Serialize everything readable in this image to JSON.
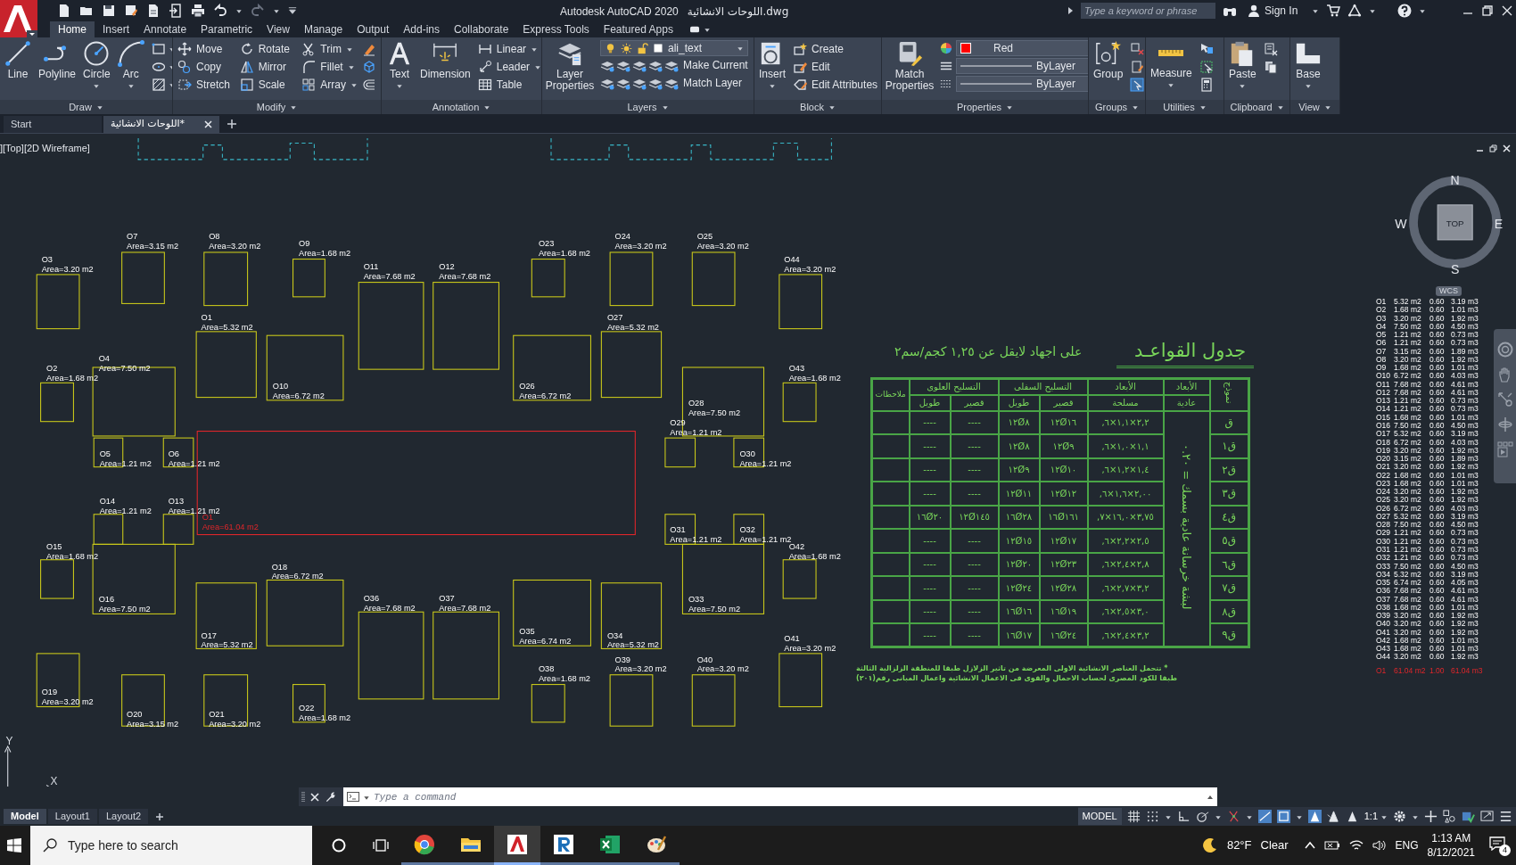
{
  "title_bar": {
    "app": "Autodesk AutoCAD 2020",
    "file": "اللوحات الانشائية.dwg",
    "search": {
      "placeholder": "Type a keyword or phrase"
    },
    "sign_in": "Sign In"
  },
  "ribbon_tabs": [
    {
      "label": "Home",
      "selected": true
    },
    {
      "label": "Insert",
      "selected": false
    },
    {
      "label": "Annotate",
      "selected": false
    },
    {
      "label": "Parametric",
      "selected": false
    },
    {
      "label": "View",
      "selected": false
    },
    {
      "label": "Manage",
      "selected": false
    },
    {
      "label": "Output",
      "selected": false
    },
    {
      "label": "Add-ins",
      "selected": false
    },
    {
      "label": "Collaborate",
      "selected": false
    },
    {
      "label": "Express Tools",
      "selected": false
    },
    {
      "label": "Featured Apps",
      "selected": false
    }
  ],
  "ribbon_panels": [
    {
      "title": "Draw",
      "tools": [
        "Line",
        "Polyline",
        "Circle",
        "Arc"
      ]
    },
    {
      "title": "Modify",
      "tools": [
        "Move",
        "Rotate",
        "Trim",
        "Copy",
        "Mirror",
        "Fillet",
        "Stretch",
        "Scale",
        "Array"
      ]
    },
    {
      "title": "Annotation",
      "tools": [
        "Text",
        "Dimension",
        "Linear",
        "Leader",
        "Table"
      ]
    },
    {
      "title": "Layers",
      "tools": [
        "Layer Properties",
        "Make Current",
        "Match Layer"
      ],
      "layer": "ali_text"
    },
    {
      "title": "Block",
      "tools": [
        "Insert",
        "Create",
        "Edit",
        "Edit Attributes"
      ]
    },
    {
      "title": "Properties",
      "tools": [
        "Match Properties"
      ],
      "color": {
        "label": "Red",
        "color": "#ff0000"
      },
      "linetype": "ByLayer",
      "lineweight": "ByLayer"
    },
    {
      "title": "Groups",
      "tools": [
        "Group"
      ]
    },
    {
      "title": "Utilities",
      "tools": [
        "Measure"
      ]
    },
    {
      "title": "Clipboard",
      "tools": [
        "Paste"
      ]
    },
    {
      "title": "View",
      "tools": [
        "Base"
      ]
    }
  ],
  "file_tabs": [
    {
      "label": "Start",
      "selected": false
    },
    {
      "label": "اللوحات الانشائية*",
      "selected": true
    }
  ],
  "viewport": {
    "label": "][Top][2D Wireframe]"
  },
  "footings": [
    {
      "name": "O3",
      "area": "Area=3.20 m2"
    },
    {
      "name": "O7",
      "area": "Area=3.15 m2"
    },
    {
      "name": "O8",
      "area": "Area=3.20 m2"
    },
    {
      "name": "O9",
      "area": "Area=1.68 m2"
    },
    {
      "name": "O11",
      "area": "Area=7.68 m2"
    },
    {
      "name": "O12",
      "area": "Area=7.68 m2"
    },
    {
      "name": "O23",
      "area": "Area=1.68 m2"
    },
    {
      "name": "O24",
      "area": "Area=3.20 m2"
    },
    {
      "name": "O25",
      "area": "Area=3.20 m2"
    },
    {
      "name": "O44",
      "area": "Area=3.20 m2"
    },
    {
      "name": "O1",
      "area": "Area=5.32 m2"
    },
    {
      "name": "O27",
      "area": "Area=5.32 m2"
    },
    {
      "name": "O10",
      "area": "Area=6.72 m2"
    },
    {
      "name": "O26",
      "area": "Area=6.72 m2"
    },
    {
      "name": "O2",
      "area": "Area=1.68 m2"
    },
    {
      "name": "O4",
      "area": "Area=7.50 m2"
    },
    {
      "name": "O43",
      "area": "Area=1.68 m2"
    },
    {
      "name": "O28",
      "area": "Area=7.50 m2"
    },
    {
      "name": "O29",
      "area": "Area=1.21 m2"
    },
    {
      "name": "O5",
      "area": "Area=1.21 m2"
    },
    {
      "name": "O6",
      "area": "Area=1.21 m2"
    },
    {
      "name": "O30",
      "area": "Area=1.21 m2"
    },
    {
      "name": "O14",
      "area": "Area=1.21 m2"
    },
    {
      "name": "O13",
      "area": "Area=1.21 m2"
    },
    {
      "name": "O31",
      "area": "Area=1.21 m2"
    },
    {
      "name": "O32",
      "area": "Area=1.21 m2"
    },
    {
      "name": "O15",
      "area": "Area=1.68 m2"
    },
    {
      "name": "O16",
      "area": "Area=7.50 m2"
    },
    {
      "name": "O42",
      "area": "Area=1.68 m2"
    },
    {
      "name": "O33",
      "area": "Area=7.50 m2"
    },
    {
      "name": "O18",
      "area": "Area=6.72 m2"
    },
    {
      "name": "O36",
      "area": "Area=7.68 m2"
    },
    {
      "name": "O37",
      "area": "Area=7.68 m2"
    },
    {
      "name": "O17",
      "area": "Area=5.32 m2"
    },
    {
      "name": "O35",
      "area": "Area=6.74 m2"
    },
    {
      "name": "O34",
      "area": "Area=5.32 m2"
    },
    {
      "name": "O41",
      "area": "Area=3.20 m2"
    },
    {
      "name": "O19",
      "area": "Area=3.20 m2"
    },
    {
      "name": "O20",
      "area": "Area=3.15 m2"
    },
    {
      "name": "O21",
      "area": "Area=3.20 m2"
    },
    {
      "name": "O22",
      "area": "Area=1.68 m2"
    },
    {
      "name": "O38",
      "area": "Area=1.68 m2"
    },
    {
      "name": "O39",
      "area": "Area=3.20 m2"
    },
    {
      "name": "O40",
      "area": "Area=3.20 m2"
    }
  ],
  "slab_outline": {
    "name": "O1",
    "area": "Area=61.04 m2",
    "color": "#e0262a"
  },
  "footing_table": {
    "title": "جدول القواعـد",
    "subtitle": "على اجهاد لايقل عن ١,٢٥ كجم/سم٢",
    "header": {
      "type": "نموذج",
      "plain": {
        "title": "الأبعاد",
        "sub": "عادية"
      },
      "rc": {
        "title": "الأبعاد",
        "sub": "مسلحة"
      },
      "bottom": {
        "title": "التسليح السفلى",
        "short": "قصير",
        "long": "طويل"
      },
      "top": {
        "title": "التسليح العلوى",
        "short": "قصير",
        "long": "طويل"
      },
      "notes": "ملاحظات"
    },
    "plain_concrete": "لبشة خرسانة عادية بسمك = ٠.٢٠",
    "rows": [
      {
        "type": "ق",
        "dims": ",٦×١,١×٢,٢",
        "bottom_short": "١٢Ø١٦",
        "bottom_long": "١٢Ø٨",
        "top_short": "----",
        "top_long": "----"
      },
      {
        "type": "ق١",
        "dims": ",٦×١,٠×١,١",
        "bottom_short": "١٢Ø٩",
        "bottom_long": "١٢Ø٨",
        "top_short": "----",
        "top_long": "----"
      },
      {
        "type": "ق٢",
        "dims": ",٦×١,٢×١,٤",
        "bottom_short": "١٢Ø١٠",
        "bottom_long": "١٢Ø٩",
        "top_short": "----",
        "top_long": "----"
      },
      {
        "type": "ق٣",
        "dims": ",٦×١,٦×٢,٠٠",
        "bottom_short": "١٢Ø١٢",
        "bottom_long": "١٢Ø١١",
        "top_short": "----",
        "top_long": "----"
      },
      {
        "type": "ق٤",
        "dims": ",٧×١٦,٠×٣,٧٥",
        "bottom_short": "١٦Ø١٦١",
        "bottom_long": "١٦Ø٢٨",
        "top_short": "١٢Ø١٤٥",
        "top_long": "١٦Ø٢٠"
      },
      {
        "type": "ق٥",
        "dims": ",٦×٢,٢×٢,٥",
        "bottom_short": "١٢Ø١٧",
        "bottom_long": "١٢Ø١٥",
        "top_short": "----",
        "top_long": "----"
      },
      {
        "type": "ق٦",
        "dims": ",٦×٢,٤×٢,٨",
        "bottom_short": "١٢Ø٢٣",
        "bottom_long": "١٢Ø٢٠",
        "top_short": "----",
        "top_long": "----"
      },
      {
        "type": "ق٧",
        "dims": ",٦×٢,٧×٣,٢",
        "bottom_short": "١٢Ø٢٨",
        "bottom_long": "١٢Ø٢٤",
        "top_short": "----",
        "top_long": "----"
      },
      {
        "type": "ق٨",
        "dims": ",٦×٢,٥×٣,٠",
        "bottom_short": "١٦Ø١٩",
        "bottom_long": "١٦Ø١٦",
        "top_short": "----",
        "top_long": "----"
      },
      {
        "type": "ق٩",
        "dims": ",٦×٢,٤×٣,٢",
        "bottom_short": "١٦Ø٢٤",
        "bottom_long": "١٦Ø١٧",
        "top_short": "----",
        "top_long": "----"
      }
    ],
    "notes": [
      "* تتحمل العناصر الانشائية الاولى المعرضة من تاثير الزلازل طبقا للمنطقة الزلزالية الثالثة",
      "طبقا للكود المصرى لحساب الاحمال والقوى فى الاعمال الانشائية واعمال المبانى رقم(٢٠١)"
    ]
  },
  "schedule": [
    {
      "name": "O1",
      "area": "5.32 m2",
      "depth": "0.60",
      "volume": "3.19 m3"
    },
    {
      "name": "O2",
      "area": "1.68 m2",
      "depth": "0.60",
      "volume": "1.01 m3"
    },
    {
      "name": "O3",
      "area": "3.20 m2",
      "depth": "0.60",
      "volume": "1.92 m3"
    },
    {
      "name": "O4",
      "area": "7.50 m2",
      "depth": "0.60",
      "volume": "4.50 m3"
    },
    {
      "name": "O5",
      "area": "1.21 m2",
      "depth": "0.60",
      "volume": "0.73 m3"
    },
    {
      "name": "O6",
      "area": "1.21 m2",
      "depth": "0.60",
      "volume": "0.73 m3"
    },
    {
      "name": "O7",
      "area": "3.15 m2",
      "depth": "0.60",
      "volume": "1.89 m3"
    },
    {
      "name": "O8",
      "area": "3.20 m2",
      "depth": "0.60",
      "volume": "1.92 m3"
    },
    {
      "name": "O9",
      "area": "1.68 m2",
      "depth": "0.60",
      "volume": "1.01 m3"
    },
    {
      "name": "O10",
      "area": "6.72 m2",
      "depth": "0.60",
      "volume": "4.03 m3"
    },
    {
      "name": "O11",
      "area": "7.68 m2",
      "depth": "0.60",
      "volume": "4.61 m3"
    },
    {
      "name": "O12",
      "area": "7.68 m2",
      "depth": "0.60",
      "volume": "4.61 m3"
    },
    {
      "name": "O13",
      "area": "1.21 m2",
      "depth": "0.60",
      "volume": "0.73 m3"
    },
    {
      "name": "O14",
      "area": "1.21 m2",
      "depth": "0.60",
      "volume": "0.73 m3"
    },
    {
      "name": "O15",
      "area": "1.68 m2",
      "depth": "0.60",
      "volume": "1.01 m3"
    },
    {
      "name": "O16",
      "area": "7.50 m2",
      "depth": "0.60",
      "volume": "4.50 m3"
    },
    {
      "name": "O17",
      "area": "5.32 m2",
      "depth": "0.60",
      "volume": "3.19 m3"
    },
    {
      "name": "O18",
      "area": "6.72 m2",
      "depth": "0.60",
      "volume": "4.03 m3"
    },
    {
      "name": "O19",
      "area": "3.20 m2",
      "depth": "0.60",
      "volume": "1.92 m3"
    },
    {
      "name": "O20",
      "area": "3.15 m2",
      "depth": "0.60",
      "volume": "1.89 m3"
    },
    {
      "name": "O21",
      "area": "3.20 m2",
      "depth": "0.60",
      "volume": "1.92 m3"
    },
    {
      "name": "O22",
      "area": "1.68 m2",
      "depth": "0.60",
      "volume": "1.01 m3"
    },
    {
      "name": "O23",
      "area": "1.68 m2",
      "depth": "0.60",
      "volume": "1.01 m3"
    },
    {
      "name": "O24",
      "area": "3.20 m2",
      "depth": "0.60",
      "volume": "1.92 m3"
    },
    {
      "name": "O25",
      "area": "3.20 m2",
      "depth": "0.60",
      "volume": "1.92 m3"
    },
    {
      "name": "O26",
      "area": "6.72 m2",
      "depth": "0.60",
      "volume": "4.03 m3"
    },
    {
      "name": "O27",
      "area": "5.32 m2",
      "depth": "0.60",
      "volume": "3.19 m3"
    },
    {
      "name": "O28",
      "area": "7.50 m2",
      "depth": "0.60",
      "volume": "4.50 m3"
    },
    {
      "name": "O29",
      "area": "1.21 m2",
      "depth": "0.60",
      "volume": "0.73 m3"
    },
    {
      "name": "O30",
      "area": "1.21 m2",
      "depth": "0.60",
      "volume": "0.73 m3"
    },
    {
      "name": "O31",
      "area": "1.21 m2",
      "depth": "0.60",
      "volume": "0.73 m3"
    },
    {
      "name": "O32",
      "area": "1.21 m2",
      "depth": "0.60",
      "volume": "0.73 m3"
    },
    {
      "name": "O33",
      "area": "7.50 m2",
      "depth": "0.60",
      "volume": "4.50 m3"
    },
    {
      "name": "O34",
      "area": "5.32 m2",
      "depth": "0.60",
      "volume": "3.19 m3"
    },
    {
      "name": "O35",
      "area": "6.74 m2",
      "depth": "0.60",
      "volume": "4.05 m3"
    },
    {
      "name": "O36",
      "area": "7.68 m2",
      "depth": "0.60",
      "volume": "4.61 m3"
    },
    {
      "name": "O37",
      "area": "7.68 m2",
      "depth": "0.60",
      "volume": "4.61 m3"
    },
    {
      "name": "O38",
      "area": "1.68 m2",
      "depth": "0.60",
      "volume": "1.01 m3"
    },
    {
      "name": "O39",
      "area": "3.20 m2",
      "depth": "0.60",
      "volume": "1.92 m3"
    },
    {
      "name": "O40",
      "area": "3.20 m2",
      "depth": "0.60",
      "volume": "1.92 m3"
    },
    {
      "name": "O41",
      "area": "3.20 m2",
      "depth": "0.60",
      "volume": "1.92 m3"
    },
    {
      "name": "O42",
      "area": "1.68 m2",
      "depth": "0.60",
      "volume": "1.01 m3"
    },
    {
      "name": "O43",
      "area": "1.68 m2",
      "depth": "0.60",
      "volume": "1.01 m3"
    },
    {
      "name": "O44",
      "area": "3.20 m2",
      "depth": "0.60",
      "volume": "1.92 m3"
    }
  ],
  "schedule_total": {
    "name": "O1",
    "area": "61.04 m2",
    "depth": "1.00",
    "volume": "61.04 m3"
  },
  "viewcube": {
    "north": "N",
    "south": "S",
    "east": "E",
    "west": "W",
    "face": "TOP",
    "ucs": "WCS"
  },
  "ucs_icon": {
    "y": "Y",
    "x": "X"
  },
  "command_line": {
    "placeholder": "Type a command"
  },
  "layout_tabs": [
    {
      "label": "Model",
      "selected": true
    },
    {
      "label": "Layout1",
      "selected": false
    },
    {
      "label": "Layout2",
      "selected": false
    }
  ],
  "status_bar": {
    "space": "MODEL",
    "scale": "1:1"
  },
  "taskbar": {
    "search": {
      "placeholder": "Type here to search"
    },
    "apps": [
      {
        "kind": "chrome",
        "selected": false
      },
      {
        "kind": "explorer",
        "selected": false
      },
      {
        "kind": "autocad",
        "selected": true
      },
      {
        "kind": "revit",
        "selected": false
      },
      {
        "kind": "excel",
        "selected": false
      },
      {
        "kind": "paint",
        "selected": false
      }
    ],
    "temperature": "82°F",
    "weather": "Clear",
    "language": "ENG",
    "time": "1:13 AM",
    "date": "8/12/2021",
    "notifications": "4"
  }
}
